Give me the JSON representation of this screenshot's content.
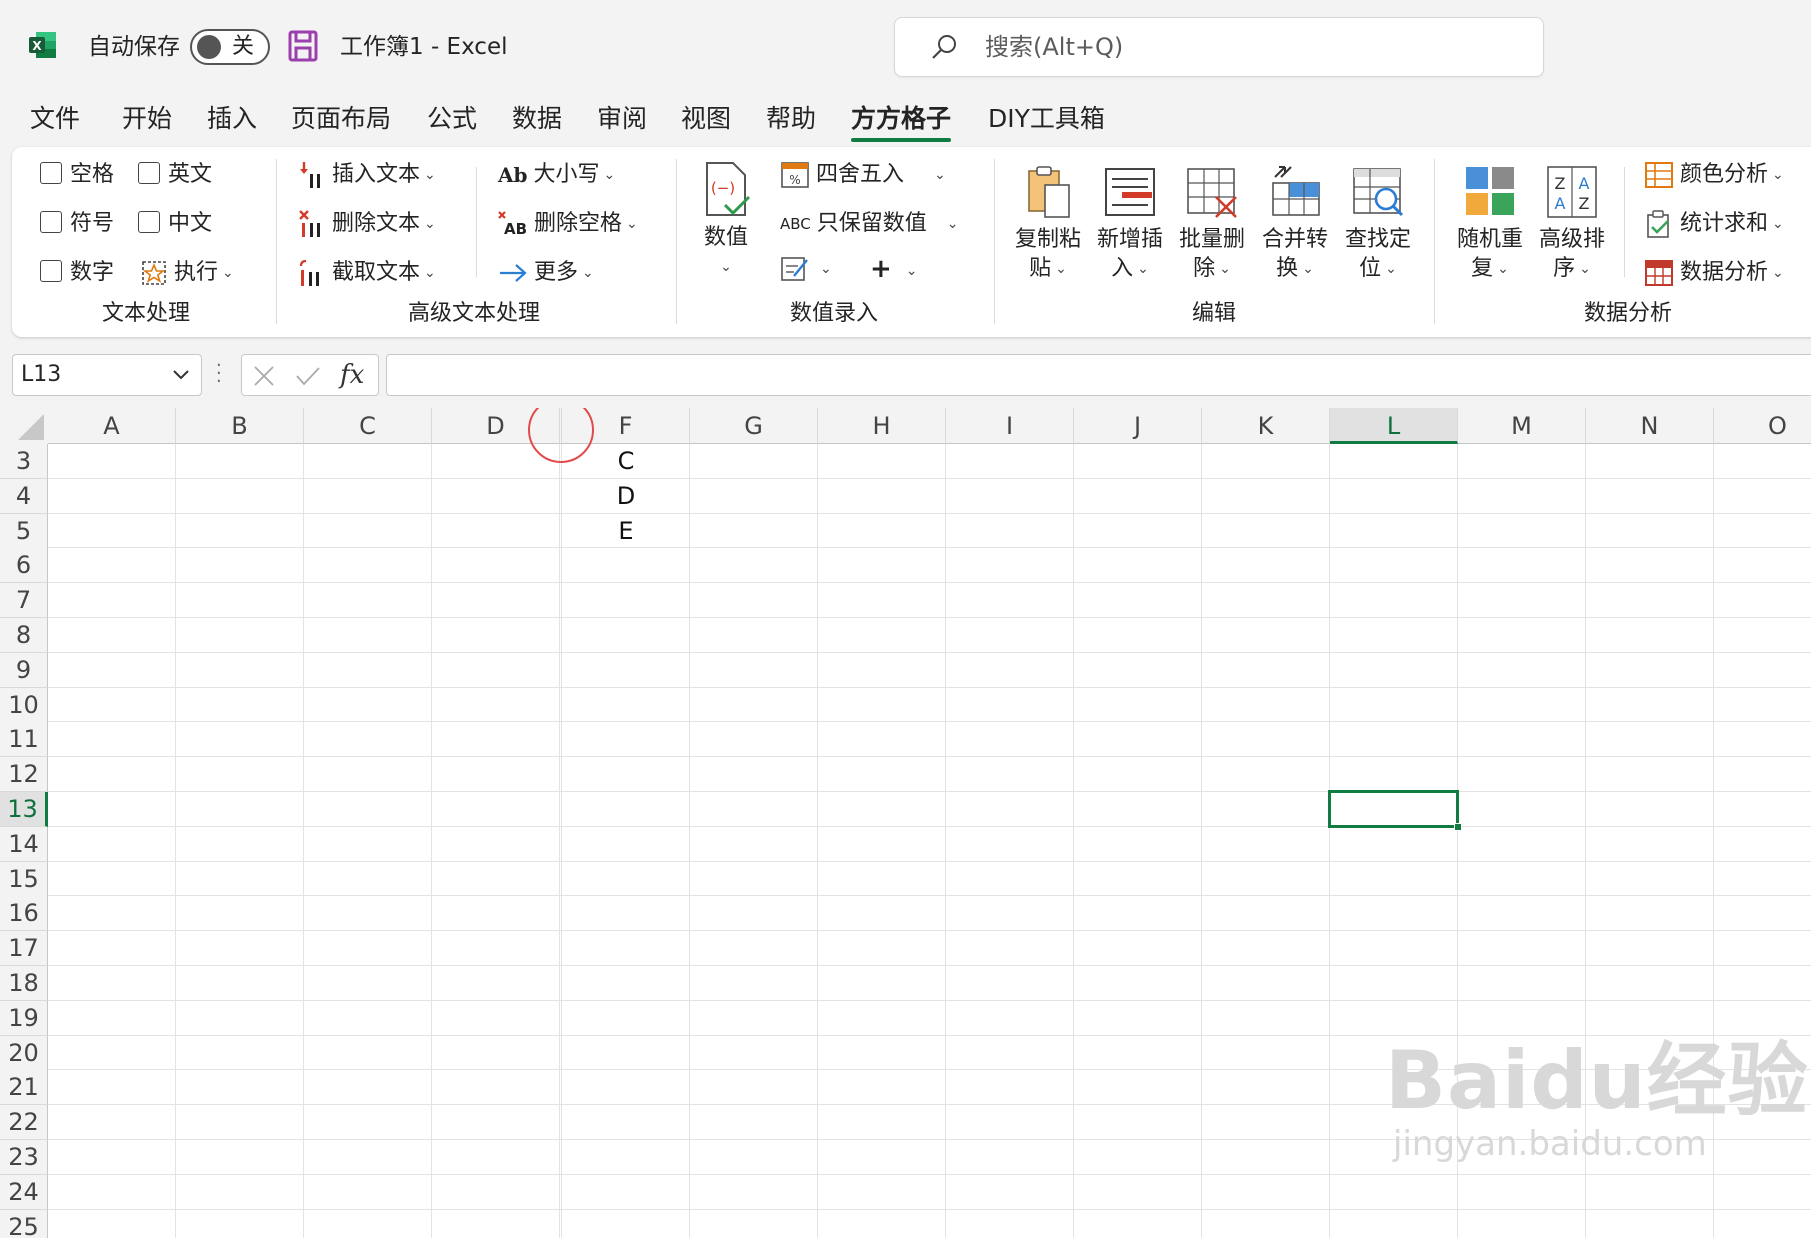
{
  "titlebar": {
    "autosave_label": "自动保存",
    "autosave_state": "关",
    "title": "工作簿1  -  Excel",
    "search_placeholder": "搜索(Alt+Q)"
  },
  "tabs": [
    "文件",
    "开始",
    "插入",
    "页面布局",
    "公式",
    "数据",
    "审阅",
    "视图",
    "帮助",
    "方方格子",
    "DIY工具箱"
  ],
  "active_tab": "方方格子",
  "ribbon": {
    "text_group": {
      "label": "文本处理",
      "checkboxes": [
        "空格",
        "英文",
        "符号",
        "中文",
        "数字"
      ],
      "execute": "执行"
    },
    "adv_text_group": {
      "label": "高级文本处理",
      "insert_text": "插入文本",
      "delete_text": "删除文本",
      "extract_text": "截取文本",
      "case": "大小写",
      "delete_space": "删除空格",
      "more": "更多"
    },
    "number_group": {
      "label": "数值录入",
      "numeric": "数值",
      "round": "四舍五入",
      "keep_numeric": "只保留数值"
    },
    "edit_group": {
      "label": "编辑",
      "copy_paste": [
        "复制粘",
        "贴"
      ],
      "insert_new": [
        "新增插",
        "入"
      ],
      "batch_delete": [
        "批量删",
        "除"
      ],
      "merge_convert": [
        "合并转",
        "换"
      ],
      "find_locate": [
        "查找定",
        "位"
      ]
    },
    "analysis_group": {
      "label": "数据分析",
      "random_repeat": [
        "随机重",
        "复"
      ],
      "advanced_sort": [
        "高级排",
        "序"
      ],
      "color_analysis": "颜色分析",
      "stat_sum": "统计求和",
      "data_analysis": "数据分析"
    }
  },
  "formula_bar": {
    "name_box": "L13",
    "fx": "fx",
    "formula": ""
  },
  "sheet": {
    "columns": [
      "A",
      "B",
      "C",
      "D",
      "",
      "F",
      "G",
      "H",
      "I",
      "J",
      "K",
      "L",
      "M",
      "N",
      "O"
    ],
    "rows": [
      "3",
      "4",
      "5",
      "6",
      "7",
      "8",
      "9",
      "10",
      "11",
      "12",
      "13",
      "14",
      "15",
      "16",
      "17",
      "18",
      "19",
      "20",
      "21",
      "22",
      "23",
      "24",
      "25"
    ],
    "selected_column": "L",
    "selected_row": "13",
    "cells": {
      "F3": "C",
      "F4": "D",
      "F5": "E"
    }
  },
  "watermark": {
    "main": "Baidu经验",
    "sub": "jingyan.baidu.com"
  },
  "colors": {
    "accent": "#107c41",
    "annotation": "#e24b4b"
  }
}
